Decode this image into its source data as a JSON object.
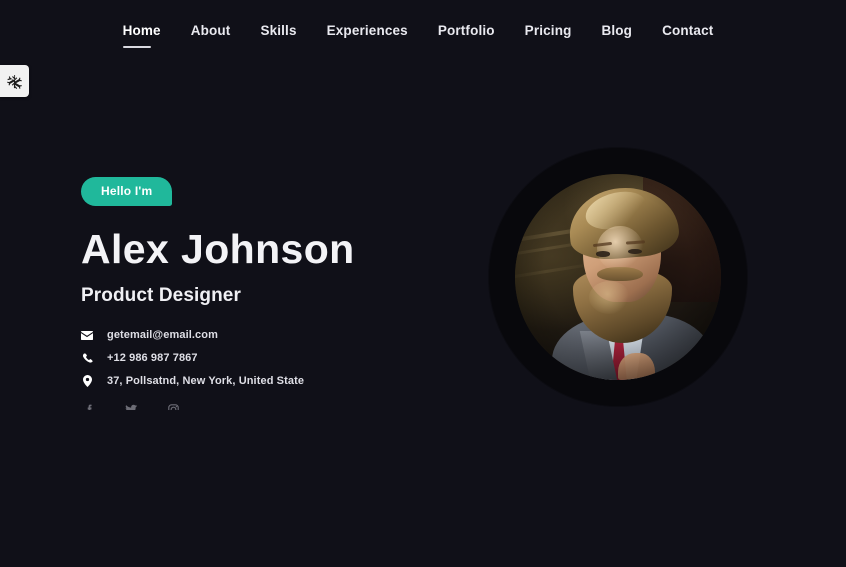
{
  "nav": {
    "items": [
      {
        "label": "Home",
        "active": true
      },
      {
        "label": "About",
        "active": false
      },
      {
        "label": "Skills",
        "active": false
      },
      {
        "label": "Experiences",
        "active": false
      },
      {
        "label": "Portfolio",
        "active": false
      },
      {
        "label": "Pricing",
        "active": false
      },
      {
        "label": "Blog",
        "active": false
      },
      {
        "label": "Contact",
        "active": false
      }
    ]
  },
  "side_toggle": {
    "icon": "snowflake-icon"
  },
  "hero": {
    "badge": "Hello I'm",
    "name": "Alex Johnson",
    "role": "Product Designer",
    "contacts": [
      {
        "icon": "envelope-icon",
        "value": "getemail@email.com"
      },
      {
        "icon": "phone-icon",
        "value": "+12 986 987 7867"
      },
      {
        "icon": "location-pin-icon",
        "value": "37, Pollsatnd, New York, United State"
      }
    ],
    "socials": [
      {
        "icon": "facebook-icon"
      },
      {
        "icon": "twitter-icon"
      },
      {
        "icon": "instagram-icon"
      }
    ],
    "portrait_alt": "Bearded man in grey suit with red tie"
  },
  "colors": {
    "background": "#101018",
    "accent": "#20b89b",
    "text_primary": "#f3f3f6",
    "text_secondary": "#dfdfe6",
    "toggle_bg": "#f1f1f1",
    "ring": "#08080c"
  }
}
